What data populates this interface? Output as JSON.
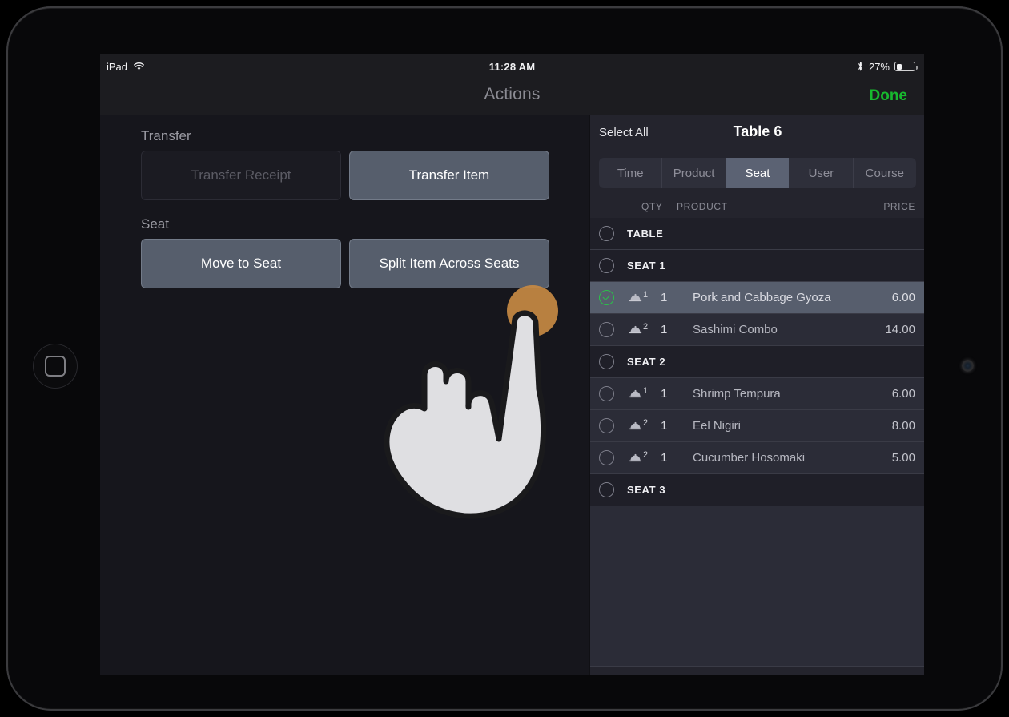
{
  "device": {
    "home_button": "home-button",
    "camera": "front-camera"
  },
  "status_bar": {
    "carrier": "iPad",
    "wifi_icon": "wifi-icon",
    "time": "11:28 AM",
    "bluetooth_icon": "bluetooth-icon",
    "battery_percent": "27%",
    "battery_level": 27
  },
  "nav": {
    "title": "Actions",
    "done_label": "Done"
  },
  "left_pane": {
    "sections": [
      {
        "label": "Transfer",
        "buttons": [
          {
            "label": "Transfer Receipt",
            "enabled": false
          },
          {
            "label": "Transfer Item",
            "enabled": true
          }
        ]
      },
      {
        "label": "Seat",
        "buttons": [
          {
            "label": "Move to Seat",
            "enabled": true
          },
          {
            "label": "Split Item Across Seats",
            "enabled": true
          }
        ]
      }
    ]
  },
  "right_pane": {
    "select_all_label": "Select All",
    "order_title": "Table 6",
    "segments": [
      {
        "label": "Time",
        "active": false
      },
      {
        "label": "Product",
        "active": false
      },
      {
        "label": "Seat",
        "active": true
      },
      {
        "label": "User",
        "active": false
      },
      {
        "label": "Course",
        "active": false
      }
    ],
    "columns": {
      "qty": "QTY",
      "product": "PRODUCT",
      "price": "PRICE"
    },
    "rows": [
      {
        "kind": "group",
        "label": "TABLE",
        "selected": false
      },
      {
        "kind": "group",
        "label": "SEAT 1",
        "selected": false
      },
      {
        "kind": "item",
        "course": "1",
        "qty": "1",
        "product": "Pork and Cabbage Gyoza",
        "price": "6.00",
        "selected": true
      },
      {
        "kind": "item",
        "course": "2",
        "qty": "1",
        "product": "Sashimi Combo",
        "price": "14.00",
        "selected": false
      },
      {
        "kind": "group",
        "label": "SEAT 2",
        "selected": false
      },
      {
        "kind": "item",
        "course": "1",
        "qty": "1",
        "product": "Shrimp Tempura",
        "price": "6.00",
        "selected": false
      },
      {
        "kind": "item",
        "course": "2",
        "qty": "1",
        "product": "Eel Nigiri",
        "price": "8.00",
        "selected": false
      },
      {
        "kind": "item",
        "course": "2",
        "qty": "1",
        "product": "Cucumber Hosomaki",
        "price": "5.00",
        "selected": false
      },
      {
        "kind": "group",
        "label": "SEAT 3",
        "selected": false
      },
      {
        "kind": "blank"
      },
      {
        "kind": "blank"
      },
      {
        "kind": "blank"
      },
      {
        "kind": "blank"
      },
      {
        "kind": "blank"
      }
    ]
  },
  "cursor": {
    "icon": "pointing-hand-cursor",
    "tap_target": "Split Item Across Seats"
  },
  "colors": {
    "accent_green": "#17b92e",
    "button_fill": "#565e6c",
    "selected_row": "#575e6d",
    "tap_ripple": "#c78a43",
    "panel_bg": "#24242d",
    "screen_bg": "#16161c"
  }
}
